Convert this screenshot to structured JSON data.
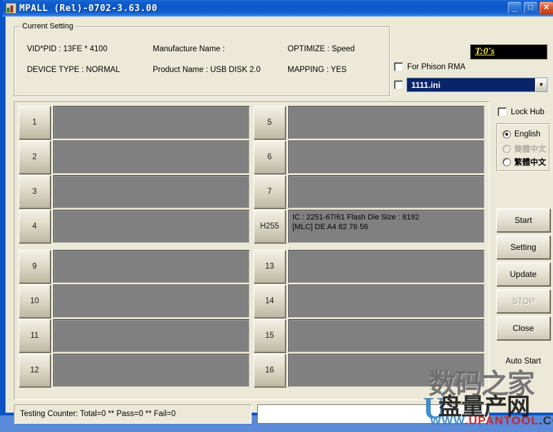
{
  "window": {
    "title": "MPALL  (Rel)-0702-3.63.00",
    "icon": "app-chip-icon",
    "minimize_label": "_",
    "maximize_label": "□",
    "close_label": "✕"
  },
  "current_setting": {
    "legend": "Current Setting",
    "vid_pid": "VID*PID : 13FE * 4100",
    "device_type": "DEVICE TYPE : NORMAL",
    "manufacture_name": "Manufacture Name :",
    "product_name": "Product Name : USB DISK 2.0",
    "optimize": "OPTIMIZE : Speed",
    "mapping": "MAPPING : YES"
  },
  "top_right": {
    "timer": "T:0's",
    "timer_color": "#f5e642",
    "phison_rma_label": "For Phison RMA",
    "phison_rma_checked": false,
    "ini_checked": false,
    "ini_value": "1111.ini",
    "ini_arrow": "▼",
    "ini_highlight_color": "#0a246a"
  },
  "ports": {
    "left": [
      {
        "num": "1",
        "lines": []
      },
      {
        "num": "2",
        "lines": []
      },
      {
        "num": "3",
        "lines": []
      },
      {
        "num": "4",
        "lines": []
      },
      {
        "num": "9",
        "lines": []
      },
      {
        "num": "10",
        "lines": []
      },
      {
        "num": "11",
        "lines": []
      },
      {
        "num": "12",
        "lines": []
      }
    ],
    "right": [
      {
        "num": "5",
        "lines": []
      },
      {
        "num": "6",
        "lines": []
      },
      {
        "num": "7",
        "lines": []
      },
      {
        "num": "H255",
        "lines": [
          "IC : 2251-67/61  Flash Die Size : 8192",
          "[MLC] DE A4 82 76 56"
        ]
      },
      {
        "num": "13",
        "lines": []
      },
      {
        "num": "14",
        "lines": []
      },
      {
        "num": "15",
        "lines": []
      },
      {
        "num": "16",
        "lines": []
      }
    ],
    "cell_color": "#808080"
  },
  "side": {
    "lock_hub_label": "Lock Hub",
    "lock_hub_checked": false,
    "languages": [
      {
        "label": "English",
        "selected": true,
        "disabled": false
      },
      {
        "label": "簡體中文",
        "selected": false,
        "disabled": true
      },
      {
        "label": "繁體中文",
        "selected": false,
        "disabled": false
      }
    ],
    "buttons": [
      {
        "label": "Start",
        "disabled": false
      },
      {
        "label": "Setting",
        "disabled": false
      },
      {
        "label": "Update",
        "disabled": false
      },
      {
        "label": "STOP",
        "disabled": true
      },
      {
        "label": "Close",
        "disabled": false
      }
    ],
    "auto_start_label": "Auto Start"
  },
  "status": {
    "testing_counter": "Testing Counter: Total=0 ** Pass=0 ** Fail=0"
  },
  "watermark": {
    "top_text": "数码之家",
    "mid_text": "盘量产网",
    "u_letter": "U",
    "url_blue": "WWW",
    "url_dot1": ".",
    "url_red": "UPANTOOL",
    "url_dot2": ".",
    "url_black": "COM"
  }
}
